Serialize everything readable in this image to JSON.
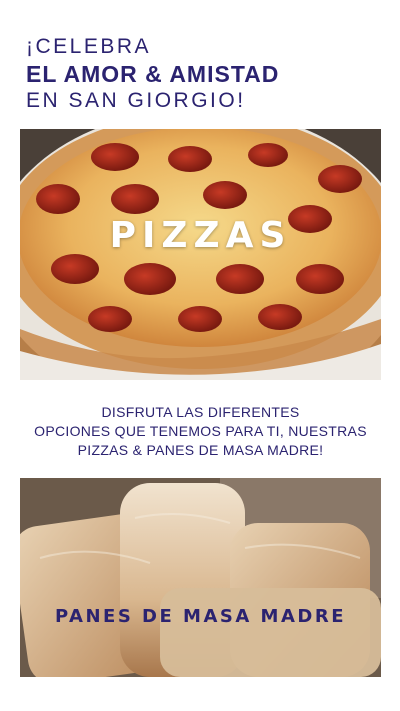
{
  "header": {
    "line1": "¡CELEBRA",
    "line2": "EL AMOR & AMISTAD",
    "line3": "EN SAN GIORGIO!"
  },
  "pizza_section": {
    "label": "PIZZAS",
    "image": "pepperoni-pizza-photo"
  },
  "description": {
    "lines": [
      "DISFRUTA LAS DIFERENTES",
      "OPCIONES QUE TENEMOS PARA TI, NUESTRAS",
      "PIZZAS & PANES DE MASA MADRE!"
    ]
  },
  "bread_section": {
    "label": "PANES DE MASA MADRE",
    "image": "sourdough-bread-photo"
  },
  "colors": {
    "brand_navy": "#2b2370",
    "background": "#ffffff"
  }
}
